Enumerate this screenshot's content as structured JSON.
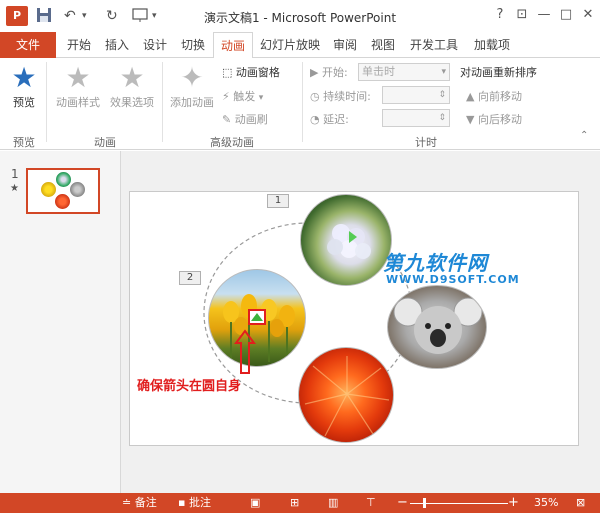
{
  "app": {
    "title": "演示文稿1 - Microsoft PowerPoint",
    "icon_text": "P"
  },
  "tabs": [
    {
      "label": "文件"
    },
    {
      "label": "开始"
    },
    {
      "label": "插入"
    },
    {
      "label": "设计"
    },
    {
      "label": "切换"
    },
    {
      "label": "动画"
    },
    {
      "label": "幻灯片放映"
    },
    {
      "label": "审阅"
    },
    {
      "label": "视图"
    },
    {
      "label": "开发工具"
    },
    {
      "label": "加载项"
    }
  ],
  "ribbon": {
    "preview_label": "预览",
    "group_preview": "预览",
    "anim_style": "动画样式",
    "effect_options": "效果选项",
    "group_animation": "动画",
    "add_animation": "添加动画",
    "anim_pane": "动画窗格",
    "trigger": "触发",
    "anim_painter": "动画刷",
    "group_advanced": "高级动画",
    "start_label": "开始:",
    "start_value": "单击时",
    "duration_label": "持续时间:",
    "delay_label": "延迟:",
    "group_timing": "计时",
    "reorder_title": "对动画重新排序",
    "move_earlier": "向前移动",
    "move_later": "向后移动"
  },
  "thumbs": {
    "slide_number": "1",
    "star": "★"
  },
  "slide": {
    "tag1": "1",
    "tag2": "2",
    "watermark_cn": "第九软件网",
    "watermark_url": "WWW.D9SOFT.COM",
    "callout": "确保箭头在圆自身"
  },
  "status": {
    "notes": "备注",
    "comments": "批注",
    "minus": "−",
    "plus": "+",
    "zoom": "35%",
    "zoom_level": 0.35
  },
  "colors": {
    "accent": "#d24726",
    "red_annotation": "#e11e1e",
    "watermark": "#1e88d6"
  }
}
